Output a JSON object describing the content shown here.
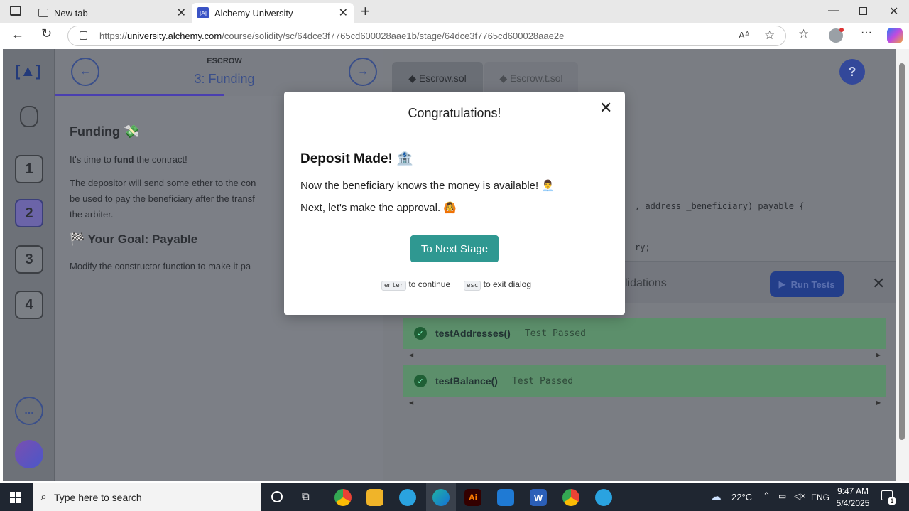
{
  "browser": {
    "tabs": [
      {
        "label": "New tab",
        "icon": "new-tab-icon",
        "active": false
      },
      {
        "label": "Alchemy University",
        "icon": "alchemy-icon",
        "active": true
      }
    ],
    "new_tab_symbol": "+",
    "window_controls": [
      "minimize",
      "restore",
      "close"
    ],
    "url_prefix": "https://",
    "url_domain": "university.alchemy.com",
    "url_path": "/course/solidity/sc/64dce3f7765cd600028aae1b/stage/64dce3f7765cd600028aae2e"
  },
  "course": {
    "section": "ESCROW",
    "stage_title": "3: Funding",
    "steps": [
      "1",
      "2",
      "3",
      "4"
    ],
    "more_label": "...",
    "help_label": "?"
  },
  "lesson": {
    "heading": "Funding",
    "p1_pre": "It's time to ",
    "p1_bold": "fund",
    "p1_post": " the contract!",
    "p2": "The depositor will send some ether to the con",
    "p2b": "be used to pay the beneficiary after the transf",
    "p2c": "the arbiter.",
    "goal": "Your Goal: Payable",
    "goal_text": "Modify the constructor function to make it pa"
  },
  "editor": {
    "files": [
      "Escrow.sol",
      "Escrow.t.sol"
    ],
    "code1": ", address _beneficiary) payable {",
    "code2": "ry;",
    "validations_label": "lidations",
    "run_tests_label": "Run Tests",
    "tests": [
      {
        "name": "testAddresses()",
        "status": "Test Passed"
      },
      {
        "name": "testBalance()",
        "status": "Test Passed"
      }
    ]
  },
  "modal": {
    "title": "Congratulations!",
    "heading": "Deposit Made!",
    "heading_emoji": "🏦",
    "line1": "Now the beneficiary knows the money is available!",
    "line1_emoji": "👨‍💼",
    "line2": "Next, let's make the approval.",
    "line2_emoji": "🙆",
    "button": "To Next Stage",
    "key_enter": "enter",
    "enter_hint": "to continue",
    "key_esc": "esc",
    "esc_hint": "to exit dialog"
  },
  "taskbar": {
    "search_placeholder": "Type here to search",
    "weather": "22°C",
    "language": "ENG",
    "time": "9:47 AM",
    "date": "5/4/2025",
    "notification_count": "1"
  },
  "colors": {
    "accent": "#2f9891",
    "test_pass": "#5c8f6b",
    "taskbar": "#1f2631"
  }
}
